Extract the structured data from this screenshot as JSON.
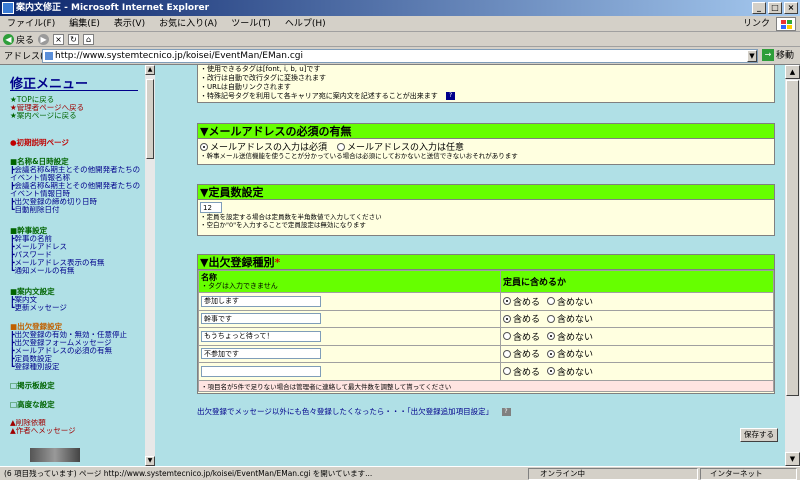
{
  "window": {
    "title": "案内文修正 - Microsoft Internet Explorer",
    "minimize": "_",
    "maximize": "□",
    "close": "×"
  },
  "menubar": {
    "items": [
      "ファイル(F)",
      "編集(E)",
      "表示(V)",
      "お気に入り(A)",
      "ツール(T)",
      "ヘルプ(H)"
    ],
    "links_label": "リンク"
  },
  "toolbar": {
    "back_label": "戻る",
    "back_glyph": "◀",
    "forward_glyph": "▶",
    "stop_glyph": "×",
    "refresh_glyph": "↻",
    "home_glyph": "⌂"
  },
  "address": {
    "label": "アドレス(D)",
    "url": "http://www.systemtecnico.jp/koisei/EventMan/EMan.cgi",
    "dropdown_glyph": "▼",
    "go_glyph": "→",
    "go_label": "移動"
  },
  "sidebar": {
    "title": "修正メニュー",
    "top_links": [
      "★TOPに戻る",
      "★管理者ページへ戻る",
      "★案内ページに戻る"
    ],
    "init_setup": "●初期説明ページ",
    "groups": [
      {
        "head": "■名称&日時設定",
        "items": [
          "┣会議名称&期主とその他開発者たちの",
          "イベント情報名称",
          "┣会議名称&期主とその他開発者たちの",
          "イベント情報日時",
          "┣出欠登録の締め切り日時",
          "┗自動削除日付"
        ]
      },
      {
        "head": "■幹事設定",
        "items": [
          "┣幹事の名前",
          "┣メールアドレス",
          "┣パスワード",
          "┣メールアドレス表示の有無",
          "┗通知メールの有無"
        ]
      },
      {
        "head": "■案内文設定",
        "items": [
          "┣案内文",
          "┗更新メッセージ"
        ]
      },
      {
        "head": "■出欠登録設定",
        "items": [
          "┣出欠登録の有効・無効・任意停止",
          "┣出欠登録フォームメッセージ",
          "┣メールアドレスの必須の有無",
          "┣定員数設定",
          "┗登録種別設定"
        ]
      }
    ],
    "board": "□掲示板設定",
    "advanced": "□高度な設定",
    "delete_request": "▲削除依頼",
    "author_message": "▲作者へメッセージ"
  },
  "panels": {
    "tag_notes": [
      "・使用できるタグは[font, i, b, u]です",
      "・改行は自動で改行タグに変換されます",
      "・URLは自動リンクされます",
      "・特殊記号タグを利用して各キャリア宛に案内文を記述することが出来ます"
    ],
    "tag_help_glyph": "?",
    "email": {
      "title": "▼メールアドレスの必須の有無",
      "option_required": "メールアドレスの入力は必須",
      "option_optional": "メールアドレスの入力は任意",
      "note": "・幹事メール送信機能を使うことが分かっている場合は必須にしておかないと送信できないおそれがあります"
    },
    "capacity": {
      "title": "▼定員数設定",
      "value": "12",
      "notes": [
        "・定員を設定する場合は定員数を半角数値で入力してください",
        "・空白か\"0\"を入力することで定員設定は無効になります"
      ]
    },
    "attendance": {
      "title": "▼出欠登録種別",
      "required_mark": "*",
      "col_name": "名称",
      "col_name_note": "・タグは入力できません",
      "col_capacity": "定員に含めるか",
      "include_label": "含める",
      "exclude_label": "含めない",
      "rows": [
        {
          "value": "参加します",
          "include": true
        },
        {
          "value": "幹事です",
          "include": true
        },
        {
          "value": "もうちょっと待って！",
          "include": false
        },
        {
          "value": "不参加です",
          "include": false
        },
        {
          "value": "",
          "include": false
        }
      ],
      "warning": "・項目名が5件で足りない場合は管理者に連絡して最大件数を調整して貰ってください"
    }
  },
  "bottom_link": "出欠登録でメッセージ以外にも色々登録したくなったら・・・「出欠登録追加項目設定」",
  "bottom_help_glyph": "?",
  "save_label": "保存する",
  "scroll": {
    "up": "▲",
    "down": "▼"
  },
  "status": {
    "text": "(6 項目残っています) ページ http://www.systemtecnico.jp/koisei/EventMan/EMan.cgi を開いています...",
    "online": "オンライン中",
    "zone": "インターネット"
  }
}
